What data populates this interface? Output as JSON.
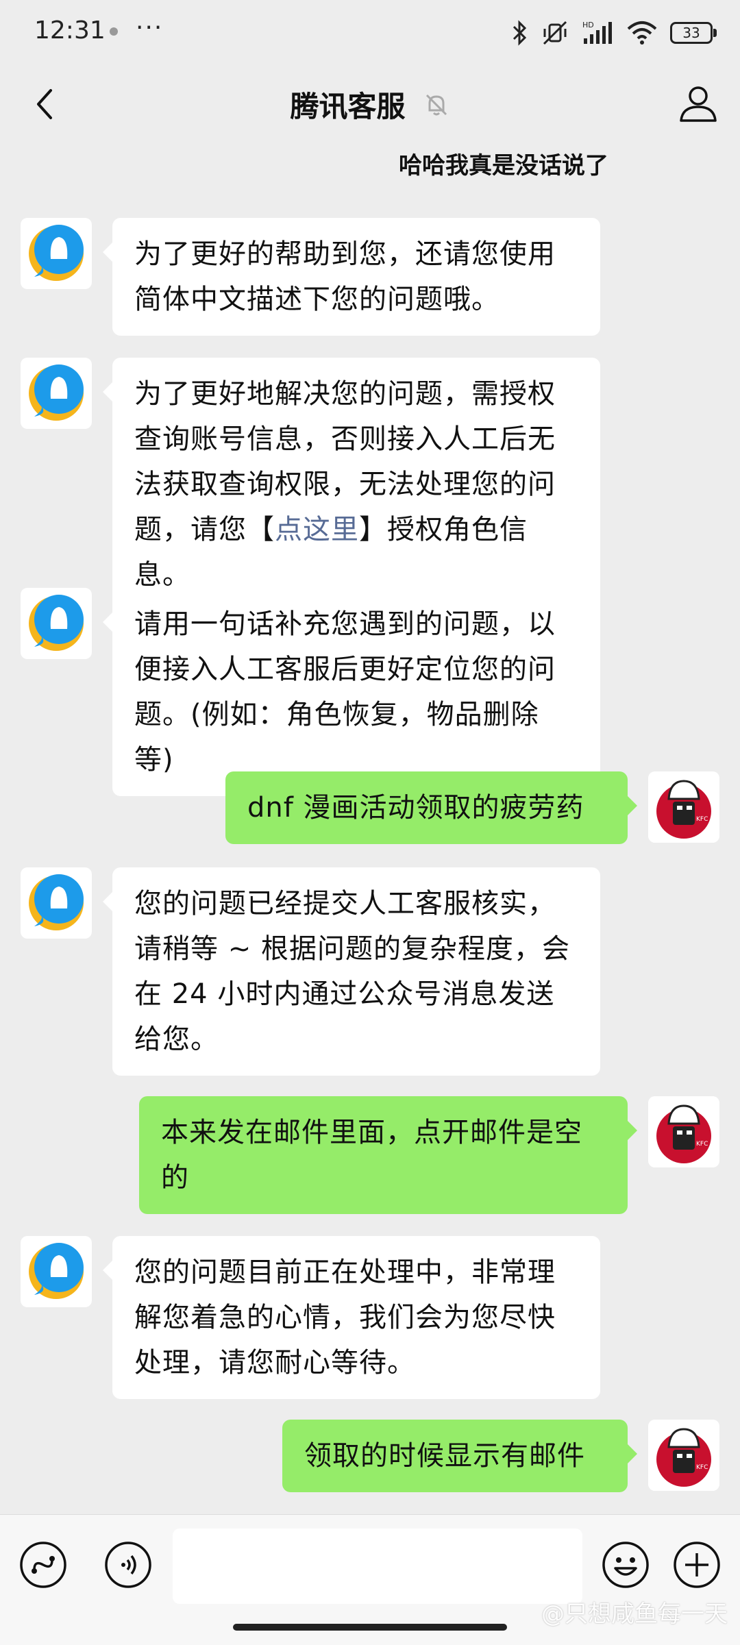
{
  "status_bar": {
    "time": "12:31",
    "more": "···",
    "battery": "33"
  },
  "header": {
    "title": "腾讯客服"
  },
  "partial_message": "哈哈我真是没话说了",
  "messages": [
    {
      "from": "bot",
      "lines": [
        "为了更好的帮助到您，还请您使用",
        "简体中文描述下您的问题哦。"
      ]
    },
    {
      "from": "bot",
      "lines": [
        "为了更好地解决您的问题，需授权",
        "查询账号信息，否则接入人工后无",
        "法获取查询权限，无法处理您的问"
      ],
      "last_prefix": "题，请您【",
      "link_text": "点这里",
      "last_suffix": "】授权角色信息。"
    },
    {
      "from": "bot",
      "lines": [
        "请用一句话补充您遇到的问题，以",
        "便接入人工客服后更好定位您的问",
        "题。(例如：角色恢复，物品删除等)"
      ]
    },
    {
      "from": "user",
      "lines": [
        "dnf 漫画活动领取的疲劳药"
      ]
    },
    {
      "from": "bot",
      "lines": [
        "您的问题已经提交人工客服核实，",
        "请稍等 ~ 根据问题的复杂程度，会",
        "在 24 小时内通过公众号消息发送",
        "给您。"
      ]
    },
    {
      "from": "user",
      "lines": [
        "本来发在邮件里面，点开邮件是空",
        "的"
      ]
    },
    {
      "from": "bot",
      "lines": [
        "您的问题目前正在处理中，非常理",
        "解您着急的心情，我们会为您尽快",
        "处理，请您耐心等待。"
      ]
    },
    {
      "from": "user",
      "lines": [
        "领取的时候显示有邮件"
      ]
    }
  ],
  "input_bar": {
    "placeholder": "",
    "watermark": "@只想咸鱼每一天"
  },
  "colors": {
    "background": "#ededed",
    "user_bubble": "#95ec69",
    "bot_bubble": "#ffffff",
    "link": "#576b95"
  }
}
